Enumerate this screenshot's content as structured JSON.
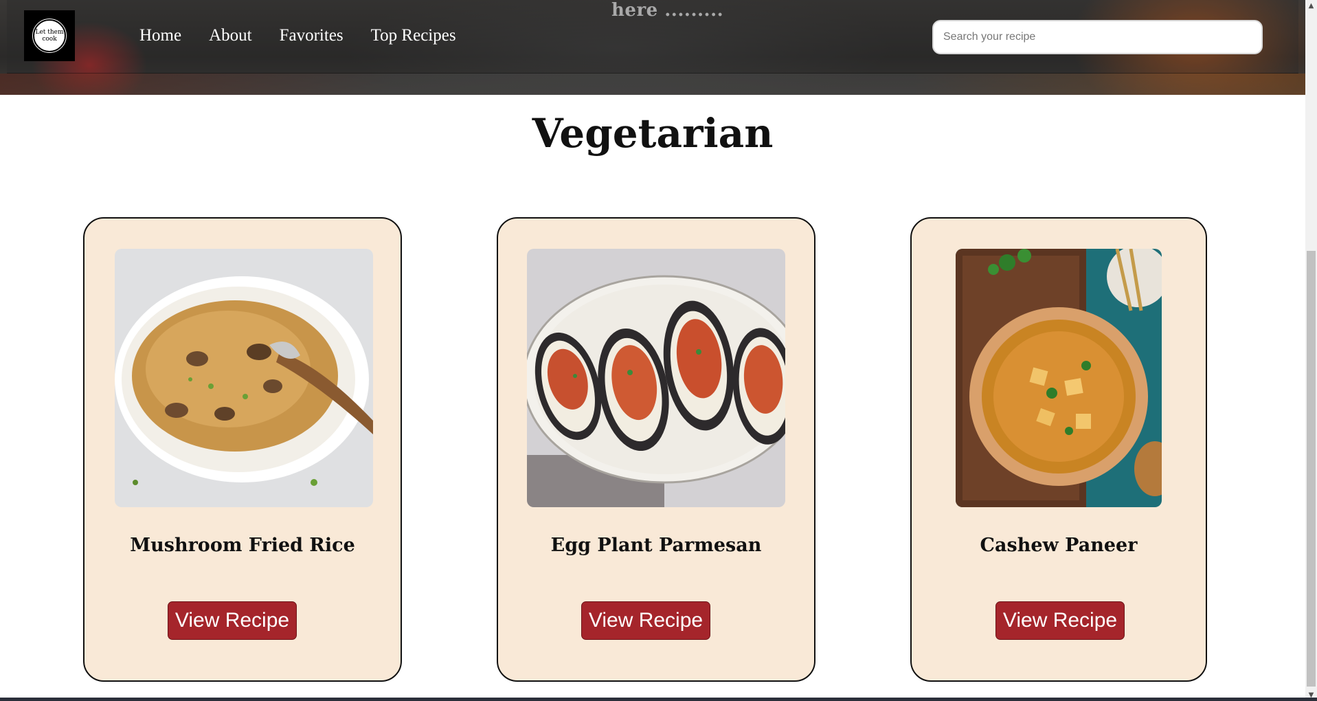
{
  "header": {
    "tagline": "here .........",
    "logo_text": "Let them cook",
    "nav": [
      "Home",
      "About",
      "Favorites",
      "Top Recipes"
    ],
    "search_placeholder": "Search your recipe"
  },
  "section": {
    "title": "Vegetarian"
  },
  "cards": [
    {
      "title": "Mushroom Fried Rice",
      "button": "View Recipe"
    },
    {
      "title": "Egg Plant Parmesan",
      "button": "View Recipe"
    },
    {
      "title": "Cashew Paneer",
      "button": "View Recipe"
    }
  ],
  "colors": {
    "card_bg": "#f9e9d7",
    "button_bg": "#a5252b",
    "nav_text": "#ffffff"
  },
  "icons": {
    "scroll_up": "▲",
    "scroll_down": "▼"
  }
}
